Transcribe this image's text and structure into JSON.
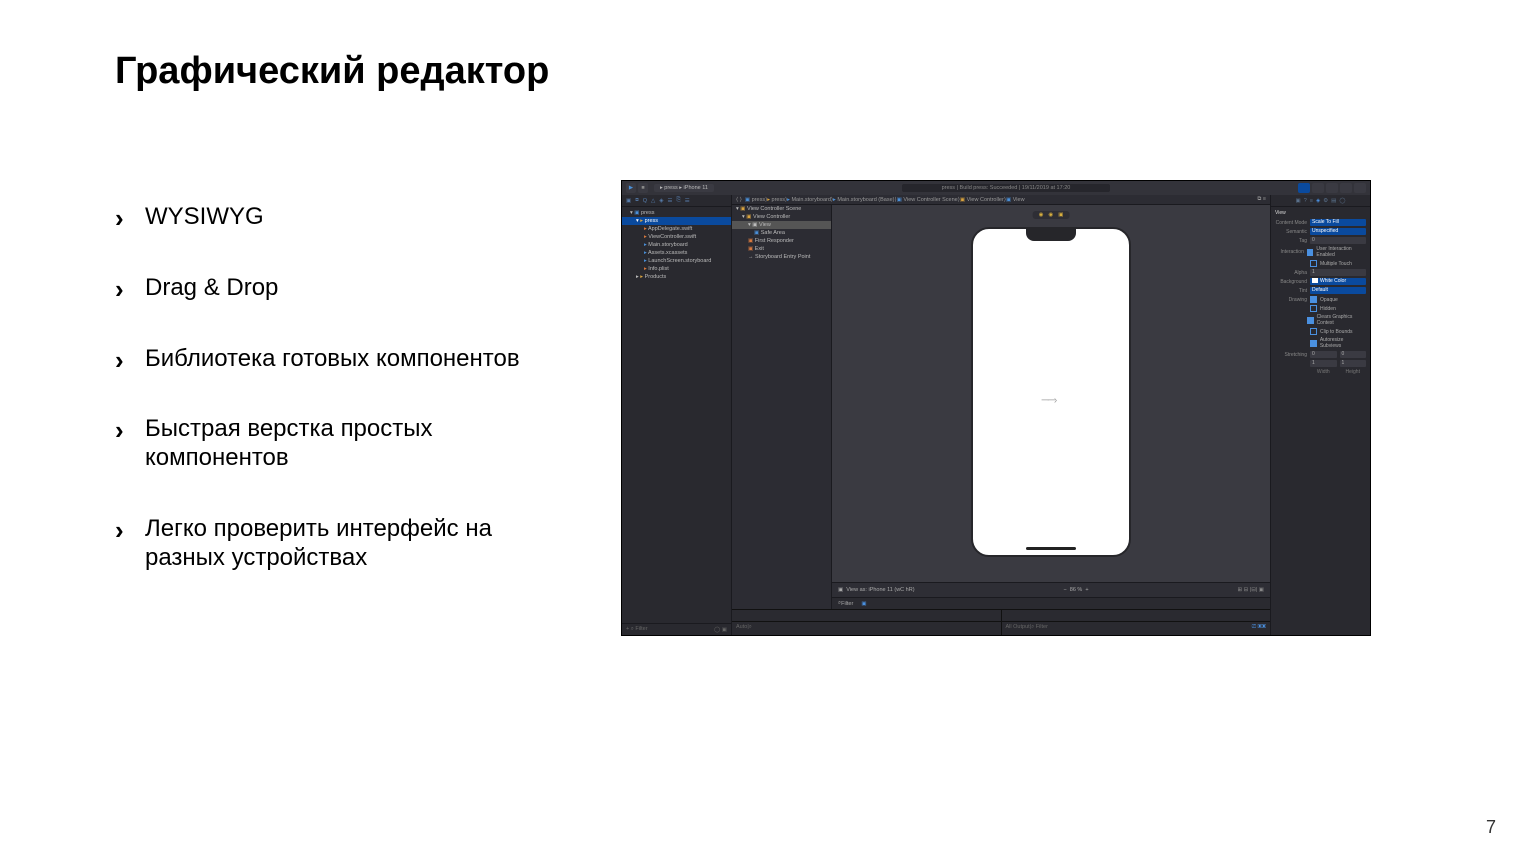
{
  "slide": {
    "title": "Графический редактор",
    "bullets": [
      "WYSIWYG",
      "Drag & Drop",
      "Библиотека готовых компонентов",
      "Быстрая верстка простых компонентов",
      "Легко проверить интерфейс на разных устройствах"
    ],
    "page_number": "7"
  },
  "xcode": {
    "scheme": "▸ press ▸ iPhone 11",
    "status": "press | Build press: Succeeded | 19/11/2019 at 17:20",
    "breadcrumb": [
      "press",
      "press",
      "Main.storyboard",
      "Main.storyboard (Base)",
      "View Controller Scene",
      "View Controller",
      "View"
    ],
    "navigator": {
      "root": "press",
      "group": "press",
      "files": [
        "AppDelegate.swift",
        "ViewController.swift",
        "Main.storyboard",
        "Assets.xcassets",
        "LaunchScreen.storyboard",
        "Info.plist"
      ],
      "products": "Products"
    },
    "outline": [
      "View Controller Scene",
      "View Controller",
      "View",
      "Safe Area",
      "First Responder",
      "Exit",
      "Storyboard Entry Point"
    ],
    "footer": {
      "view_as": "View as: iPhone 11 (​wC hR)",
      "zoom": "86 %",
      "filter": "Filter"
    },
    "inspector": {
      "section": "View",
      "content_mode": {
        "label": "Content Mode",
        "value": "Scale To Fill"
      },
      "semantic": {
        "label": "Semantic",
        "value": "Unspecified"
      },
      "tag": {
        "label": "Tag",
        "value": "0"
      },
      "interaction": {
        "label": "Interaction",
        "opt1": "User Interaction Enabled",
        "opt2": "Multiple Touch"
      },
      "alpha": {
        "label": "Alpha",
        "value": "1"
      },
      "background": {
        "label": "Background",
        "value": "White Color"
      },
      "tint": {
        "label": "Tint",
        "value": "Default"
      },
      "drawing": {
        "label": "Drawing",
        "opts": [
          "Opaque",
          "Hidden",
          "Clears Graphics Context",
          "Clip to Bounds",
          "Autoresize Subviews"
        ]
      },
      "stretching": {
        "label": "Stretching",
        "x": "0",
        "y": "0",
        "w": "1",
        "h": "1",
        "wlabel": "Width",
        "hlabel": "Height"
      }
    },
    "debug": {
      "auto": "Auto",
      "all_output": "All Output",
      "filter": "Filter"
    }
  }
}
